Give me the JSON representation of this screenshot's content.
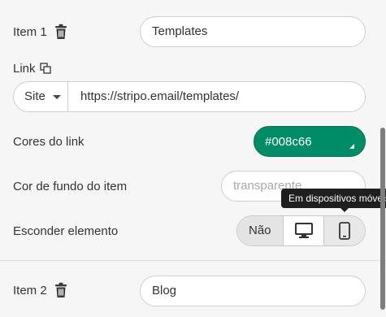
{
  "item1": {
    "label": "Item 1",
    "icon": "trash-icon",
    "value": "Templates"
  },
  "link": {
    "label": "Link",
    "icon": "copy-icon",
    "type_selected": "Site",
    "url": "https://stripo.email/templates/"
  },
  "link_color": {
    "label": "Cores do link",
    "value": "#008c66",
    "swatch": "#008c66"
  },
  "item_bg": {
    "label": "Cor de fundo do item",
    "placeholder": "transparente"
  },
  "hide_element": {
    "label": "Esconder elemento",
    "options": {
      "no": "Não",
      "desktop_icon": "desktop-icon",
      "mobile_icon": "mobile-icon"
    },
    "selected": "no"
  },
  "tooltip": {
    "text": "Em dispositivos móveis"
  },
  "item2": {
    "label": "Item 2",
    "icon": "trash-icon",
    "value": "Blog"
  }
}
